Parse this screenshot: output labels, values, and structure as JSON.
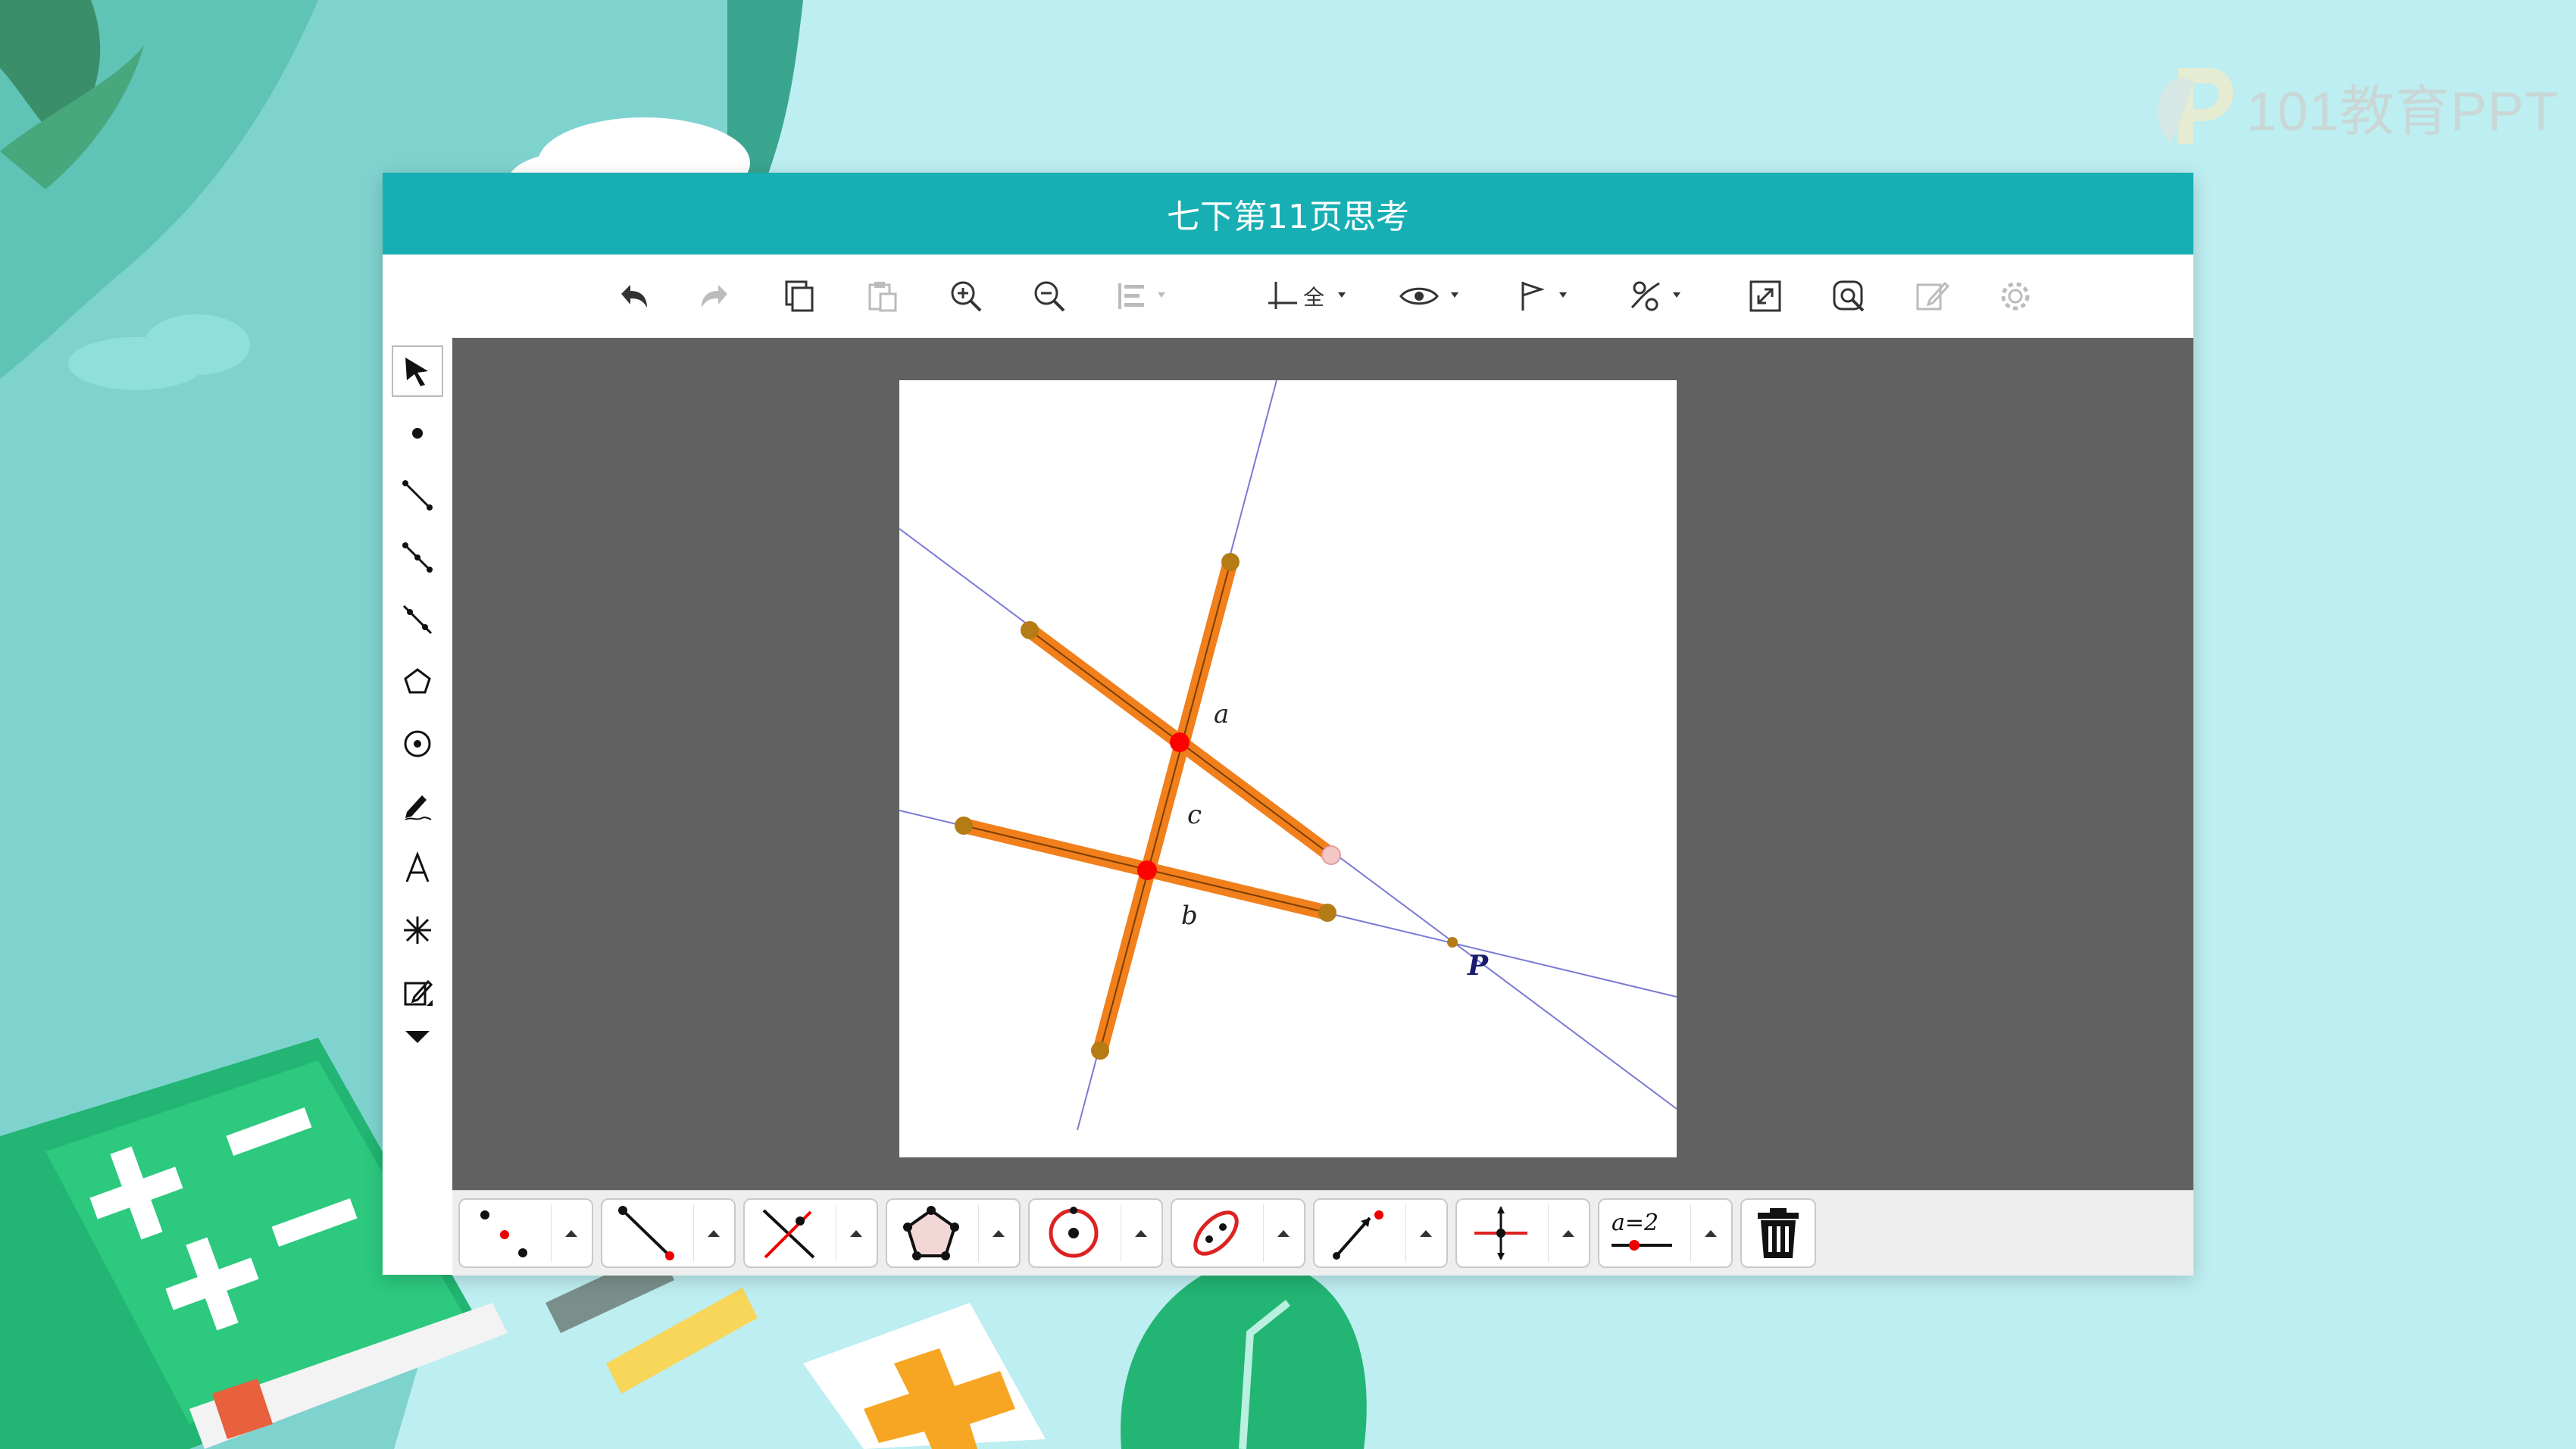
{
  "watermark": {
    "text": "101教育PPT"
  },
  "window": {
    "title": "七下第11页思考"
  },
  "toolbar": {
    "buttons": [
      "undo-icon",
      "redo-icon",
      "copy-icon",
      "paste-icon",
      "zoom-in-icon",
      "zoom-out-icon",
      "align-icon",
      "axes-grid-icon",
      "visibility-icon",
      "flag-icon",
      "style-icon",
      "fullscreen-icon",
      "search-icon",
      "edit-icon",
      "settings-icon"
    ]
  },
  "canvas": {
    "labels": {
      "a": "a",
      "b": "b",
      "c": "c",
      "p": "P"
    },
    "colors": {
      "stick": "#f07f1c",
      "line": "#7a7ad6",
      "intersection": "#ff0000",
      "endpoint": "#b57b14"
    }
  },
  "bottom_tools": [
    "point-tool",
    "line-tool",
    "perpendicular-tool",
    "polygon-tool",
    "circle-tool",
    "conic-tool",
    "ray-tool",
    "move-tool",
    "slider-tool",
    "delete-tool"
  ],
  "slider_label": "a=2"
}
